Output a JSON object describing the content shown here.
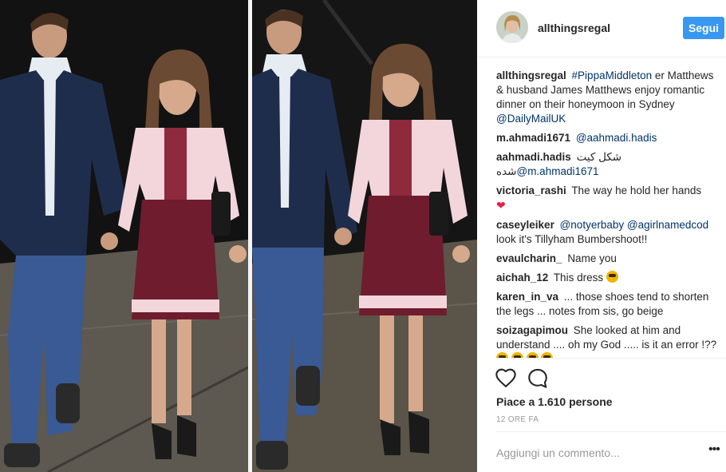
{
  "post": {
    "username": "allthingsregal",
    "follow_label": "Segui",
    "caption": {
      "username": "allthingsregal",
      "hashtag": "#PippaMiddleton",
      "text": "er Matthews & husband James Matthews enjoy romantic dinner on their honeymoon in Sydney",
      "mention": "@DailyMailUK"
    },
    "comments": [
      {
        "username": "m.ahmadi1671",
        "mention": "@aahmadi.hadis",
        "text": ""
      },
      {
        "username": "aahmadi.hadis",
        "text": "شکل کیت",
        "text2": "شده",
        "mention": "@m.ahmadi1671"
      },
      {
        "username": "victoria_rashi",
        "text": "The way he hold her hands",
        "emoji": "red-heart"
      },
      {
        "username": "caseyleiker",
        "mention": "@notyerbaby",
        "mention2": "@agirlnamedcod",
        "text": "look it's Tillyham Bumbershoot!!"
      },
      {
        "username": "evaulcharin_",
        "text": "Name you"
      },
      {
        "username": "aichah_12",
        "text": "This dress",
        "emoji": "heart-eyes"
      },
      {
        "username": "karen_in_va",
        "text": "... those shoes tend to shorten the legs ... notes from sis, go beige"
      },
      {
        "username": "soizagapimou",
        "text": "She looked at him and understand .... oh my God ..... is it an error !??",
        "emoji": "laughing-tears-x4"
      }
    ],
    "likes_text": "Piace a 1.610 persone",
    "timestamp": "12 ORE FA",
    "add_comment_placeholder": "Aggiungi un commento...",
    "more_label": "•••"
  },
  "icons": {
    "like": "heart-outline-icon",
    "comment": "speech-bubble-icon",
    "more": "more-options-icon"
  },
  "colors": {
    "accent": "#3897f0",
    "link": "#003569",
    "text": "#262626",
    "muted": "#999999",
    "heart": "#ed1c3f"
  }
}
